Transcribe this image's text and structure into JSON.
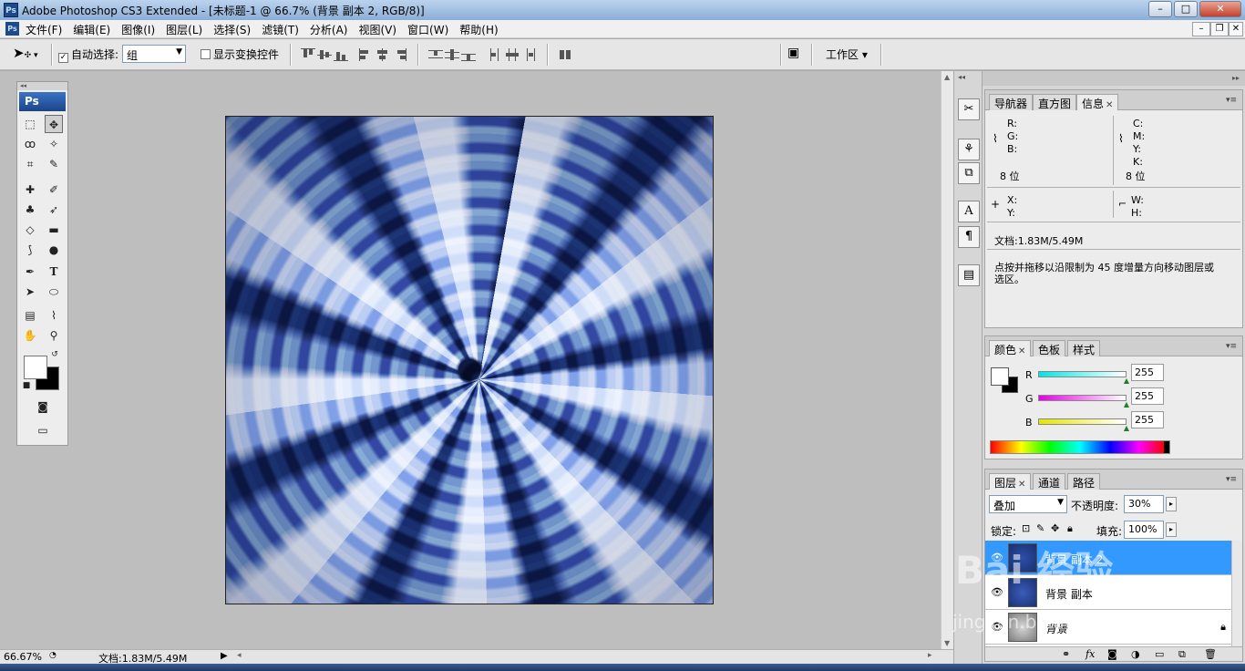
{
  "titlebar": {
    "title": "Adobe Photoshop CS3 Extended - [未标题-1 @ 66.7% (背景 副本 2, RGB/8)]",
    "app_icon": "Ps",
    "minimize": "–",
    "maximize": "□",
    "close": "✕"
  },
  "menubar": {
    "app_icon": "Ps",
    "items": [
      "文件(F)",
      "编辑(E)",
      "图像(I)",
      "图层(L)",
      "选择(S)",
      "滤镜(T)",
      "分析(A)",
      "视图(V)",
      "窗口(W)",
      "帮助(H)"
    ],
    "mdi_minimize": "–",
    "mdi_restore": "❐",
    "mdi_close": "✕"
  },
  "options": {
    "auto_select_label": "自动选择:",
    "auto_select_checked": true,
    "auto_select_value": "组",
    "show_transform_label": "显示变换控件",
    "show_transform_checked": false,
    "workspace_label": "工作区 ▾"
  },
  "toolbox": {
    "logo": "Ps",
    "grip": "◂◂"
  },
  "statusbar": {
    "zoom": "66.67%",
    "doc": "文档:1.83M/5.49M"
  },
  "info_panel": {
    "tabs": [
      "导航器",
      "直方图",
      "信息"
    ],
    "active_tab": "信息",
    "labels_left": [
      "R:",
      "G:",
      "B:"
    ],
    "labels_right": [
      "C:",
      "M:",
      "Y:",
      "K:"
    ],
    "bits_left": "8 位",
    "bits_right": "8 位",
    "xy": [
      "X:",
      "Y:"
    ],
    "wh": [
      "W:",
      "H:"
    ],
    "doc": "文档:1.83M/5.49M",
    "hint_line1": "点按并拖移以沿限制为 45 度增量方向移动图层或",
    "hint_line2": "选区。"
  },
  "color_panel": {
    "tabs": [
      "颜色",
      "色板",
      "样式"
    ],
    "active_tab": "颜色",
    "channels": [
      {
        "label": "R",
        "value": "255",
        "color": "#00e5e5"
      },
      {
        "label": "G",
        "value": "255",
        "color": "#e500e5"
      },
      {
        "label": "B",
        "value": "255",
        "color": "#e5e500"
      }
    ]
  },
  "layers_panel": {
    "tabs": [
      "图层",
      "通道",
      "路径"
    ],
    "active_tab": "图层",
    "blend_mode": "叠加",
    "opacity_label": "不透明度:",
    "opacity_value": "30%",
    "lock_label": "锁定:",
    "fill_label": "填充:",
    "fill_value": "100%",
    "layers": [
      {
        "name": "背景 副本 2",
        "selected": true,
        "locked": false
      },
      {
        "name": "背景 副本",
        "selected": false,
        "locked": false
      },
      {
        "name": "背景",
        "selected": false,
        "locked": true
      }
    ]
  },
  "watermark": {
    "logo_text": "Bai 经验",
    "url": "jingyan.baidu.com"
  },
  "colors": {
    "selection": "#3399ff",
    "titlebar": "#8aaed6"
  }
}
